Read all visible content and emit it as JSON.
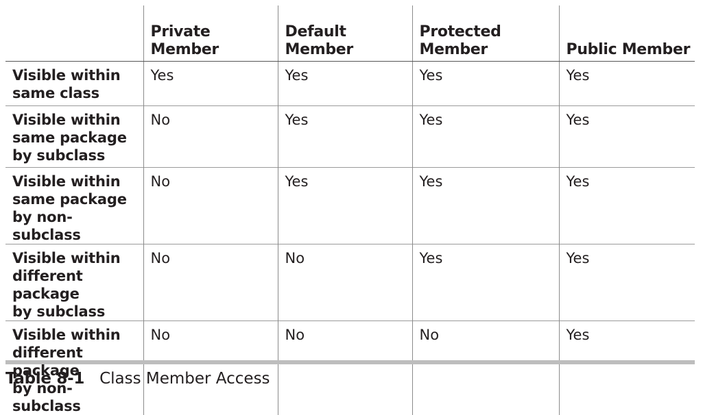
{
  "table": {
    "columns": [
      "",
      "Private Member",
      "Default Member",
      "Protected Member",
      "Public Member"
    ],
    "rows": [
      {
        "label_lines": [
          "Visible within",
          "same class"
        ],
        "values": [
          "Yes",
          "Yes",
          "Yes",
          "Yes"
        ]
      },
      {
        "label_lines": [
          "Visible within",
          "same package",
          "by subclass"
        ],
        "values": [
          "No",
          "Yes",
          "Yes",
          "Yes"
        ]
      },
      {
        "label_lines": [
          "Visible within",
          "same package",
          "by non-subclass"
        ],
        "values": [
          "No",
          "Yes",
          "Yes",
          "Yes"
        ]
      },
      {
        "label_lines": [
          "Visible within",
          "different package",
          "by subclass"
        ],
        "values": [
          "No",
          "No",
          "Yes",
          "Yes"
        ]
      },
      {
        "label_lines": [
          "Visible within",
          "different package",
          "by non-subclass"
        ],
        "values": [
          "No",
          "No",
          "No",
          "Yes"
        ]
      }
    ]
  },
  "caption": {
    "label": "Table 8-1",
    "title": "Class Member Access"
  }
}
